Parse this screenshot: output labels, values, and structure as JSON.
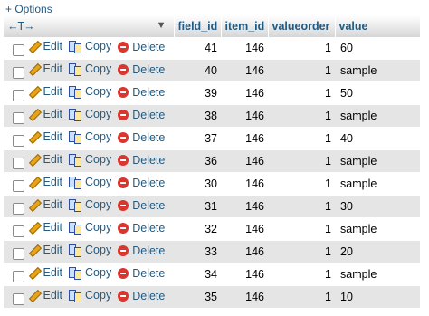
{
  "toolbar": {
    "options_label": "+ Options"
  },
  "header": {
    "controls_symbol": "←T→",
    "sort_symbol": "▼",
    "columns": [
      "field_id",
      "item_id",
      "valueorder",
      "value"
    ]
  },
  "actions": {
    "edit": "Edit",
    "copy": "Copy",
    "delete": "Delete"
  },
  "rows": [
    {
      "field_id": "41",
      "item_id": "146",
      "valueorder": "1",
      "value": "60"
    },
    {
      "field_id": "40",
      "item_id": "146",
      "valueorder": "1",
      "value": "sample"
    },
    {
      "field_id": "39",
      "item_id": "146",
      "valueorder": "1",
      "value": "50"
    },
    {
      "field_id": "38",
      "item_id": "146",
      "valueorder": "1",
      "value": "sample"
    },
    {
      "field_id": "37",
      "item_id": "146",
      "valueorder": "1",
      "value": "40"
    },
    {
      "field_id": "36",
      "item_id": "146",
      "valueorder": "1",
      "value": "sample"
    },
    {
      "field_id": "30",
      "item_id": "146",
      "valueorder": "1",
      "value": "sample"
    },
    {
      "field_id": "31",
      "item_id": "146",
      "valueorder": "1",
      "value": "30"
    },
    {
      "field_id": "32",
      "item_id": "146",
      "valueorder": "1",
      "value": "sample"
    },
    {
      "field_id": "33",
      "item_id": "146",
      "valueorder": "1",
      "value": "20"
    },
    {
      "field_id": "34",
      "item_id": "146",
      "valueorder": "1",
      "value": "sample"
    },
    {
      "field_id": "35",
      "item_id": "146",
      "valueorder": "1",
      "value": "10"
    }
  ]
}
